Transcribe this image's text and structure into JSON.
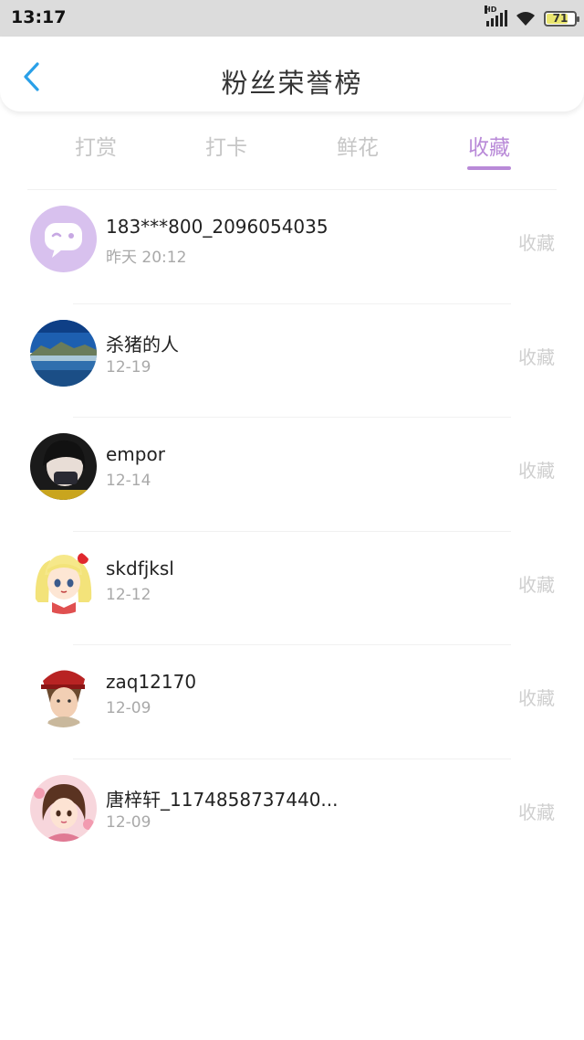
{
  "status_bar": {
    "time": "13:17",
    "network_label": "HD",
    "battery_level": "71",
    "battery_fraction": 0.71,
    "icons": [
      "signal-icon",
      "wifi-icon",
      "battery-icon"
    ]
  },
  "header": {
    "title": "粉丝荣誉榜",
    "back_icon": "chevron-left-icon",
    "back_color": "#2aa0e8"
  },
  "tabs": [
    {
      "label": "打赏",
      "active": false
    },
    {
      "label": "打卡",
      "active": false
    },
    {
      "label": "鲜花",
      "active": false
    },
    {
      "label": "收藏",
      "active": true
    }
  ],
  "colors": {
    "accent": "#b98ad8",
    "inactive_text": "#c6c6c6",
    "secondary_text": "#a9a9a9"
  },
  "fans": [
    {
      "name": "183***800_2096054035",
      "date": "昨天 20:12",
      "action": "收藏",
      "avatar": "default-chat-avatar"
    },
    {
      "name": "杀猪的人",
      "date": "12-19",
      "action": "收藏",
      "avatar": "landscape-lake-avatar"
    },
    {
      "name": "empor",
      "date": "12-14",
      "action": "收藏",
      "avatar": "girl-photo-avatar"
    },
    {
      "name": "skdfjksl",
      "date": "12-12",
      "action": "收藏",
      "avatar": "anime-sailor-avatar"
    },
    {
      "name": "zaq12170",
      "date": "12-09",
      "action": "收藏",
      "avatar": "boy-red-cap-avatar"
    },
    {
      "name": "唐梓轩_1174858737440...",
      "date": "12-09",
      "action": "收藏",
      "avatar": "cartoon-girl-avatar"
    }
  ]
}
